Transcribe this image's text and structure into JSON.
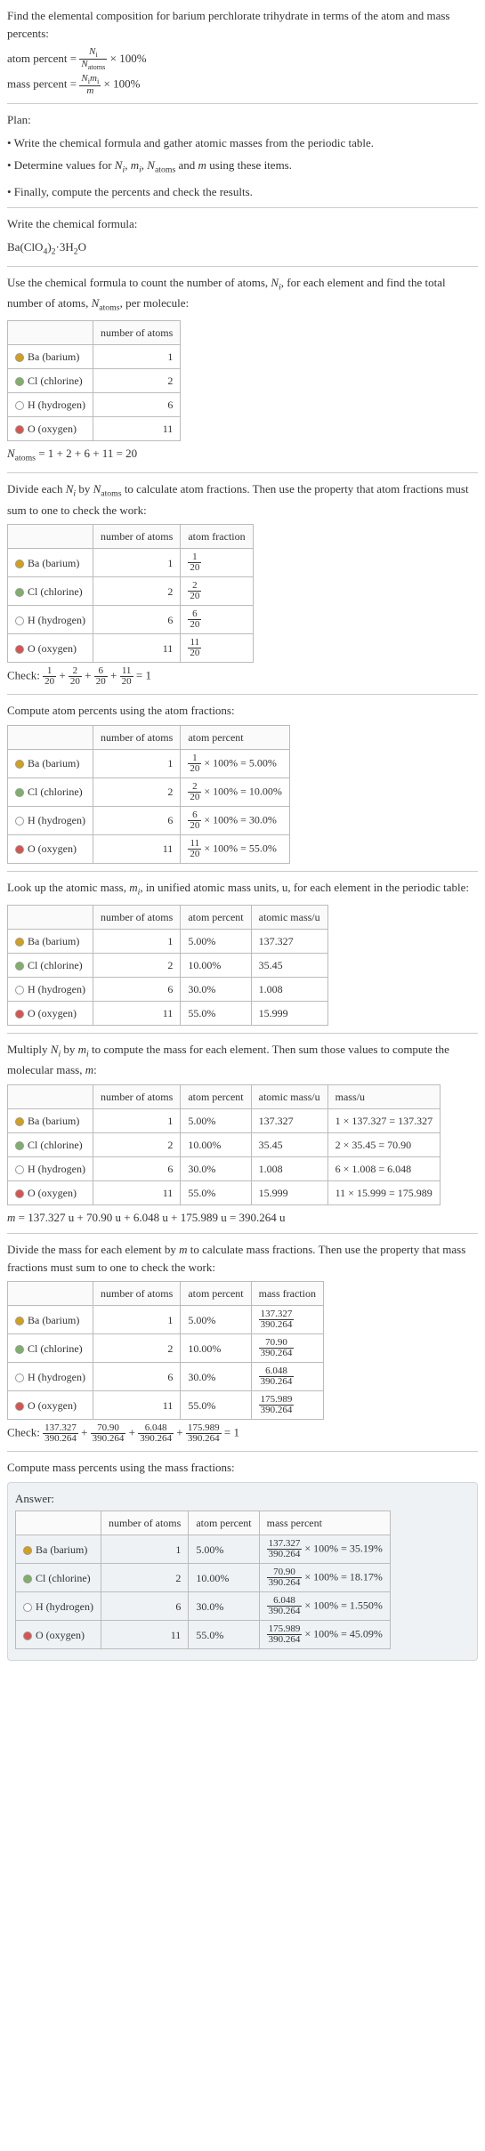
{
  "intro": {
    "title": "Find the elemental composition for barium perchlorate trihydrate in terms of the atom and mass percents:",
    "atom_percent_label": "atom percent",
    "atom_percent_eq_lhs": "N",
    "atom_percent_eq_sub_i": "i",
    "atom_percent_eq_denom": "N",
    "atom_percent_eq_denom_sub": "atoms",
    "times100": "× 100%",
    "mass_percent_label": "mass percent",
    "mass_num_N": "N",
    "mass_num_i": "i",
    "mass_num_m": "m",
    "mass_denom": "m"
  },
  "plan": {
    "heading": "Plan:",
    "b1": "• Write the chemical formula and gather atomic masses from the periodic table.",
    "b2_pre": "• Determine values for ",
    "b2_post": " using these items.",
    "b3": "• Finally, compute the percents and check the results."
  },
  "formula_section": {
    "heading": "Write the chemical formula:",
    "formula": "Ba(ClO",
    "sub4": "4",
    "paren": ")",
    "sub2": "2",
    "dot": "·3H",
    "sub2b": "2",
    "O": "O"
  },
  "count_section": {
    "intro_pre": "Use the chemical formula to count the number of atoms, ",
    "intro_post": ", for each element and find the total number of atoms, ",
    "intro_post2": ", per molecule:",
    "col_num": "number of atoms",
    "row_ba": "Ba (barium)",
    "val_ba": "1",
    "row_cl": "Cl (chlorine)",
    "val_cl": "2",
    "row_h": "H (hydrogen)",
    "val_h": "6",
    "row_o": "O (oxygen)",
    "val_o": "11",
    "sum": " = 1 + 2 + 6 + 11 = 20"
  },
  "frac_section": {
    "intro_pre": "Divide each ",
    "intro_mid": " by ",
    "intro_post": " to calculate atom fractions. Then use the property that atom fractions must sum to one to check the work:",
    "col_num": "number of atoms",
    "col_frac": "atom fraction",
    "row_ba": "Ba (barium)",
    "nba": "1",
    "fba_n": "1",
    "fba_d": "20",
    "row_cl": "Cl (chlorine)",
    "ncl": "2",
    "fcl_n": "2",
    "fcl_d": "20",
    "row_h": "H (hydrogen)",
    "nh": "6",
    "fh_n": "6",
    "fh_d": "20",
    "row_o": "O (oxygen)",
    "no": "11",
    "fo_n": "11",
    "fo_d": "20",
    "check_label": "Check: ",
    "check_eq": " = 1"
  },
  "atom_pct_section": {
    "intro": "Compute atom percents using the atom fractions:",
    "col_num": "number of atoms",
    "col_pct": "atom percent",
    "row_ba": "Ba (barium)",
    "nba": "1",
    "pba_n": "1",
    "pba_d": "20",
    "pba_val": " × 100% = 5.00%",
    "row_cl": "Cl (chlorine)",
    "ncl": "2",
    "pcl_n": "2",
    "pcl_d": "20",
    "pcl_val": " × 100% = 10.00%",
    "row_h": "H (hydrogen)",
    "nh": "6",
    "ph_n": "6",
    "ph_d": "20",
    "ph_val": " × 100% = 30.0%",
    "row_o": "O (oxygen)",
    "no": "11",
    "po_n": "11",
    "po_d": "20",
    "po_val": " × 100% = 55.0%"
  },
  "mass_section": {
    "intro_pre": "Look up the atomic mass, ",
    "intro_post": ", in unified atomic mass units, u, for each element in the periodic table:",
    "col_num": "number of atoms",
    "col_pct": "atom percent",
    "col_mass": "atomic mass/u",
    "row_ba": "Ba (barium)",
    "nba": "1",
    "pba": "5.00%",
    "mba": "137.327",
    "row_cl": "Cl (chlorine)",
    "ncl": "2",
    "pcl": "10.00%",
    "mcl": "35.45",
    "row_h": "H (hydrogen)",
    "nh": "6",
    "ph": "30.0%",
    "mh": "1.008",
    "row_o": "O (oxygen)",
    "no": "11",
    "po": "55.0%",
    "mo": "15.999"
  },
  "molmass_section": {
    "intro_pre": "Multiply ",
    "intro_mid": " by ",
    "intro_post": " to compute the mass for each element. Then sum those values to compute the molecular mass, ",
    "intro_post2": ":",
    "col_num": "number of atoms",
    "col_pct": "atom percent",
    "col_amass": "atomic mass/u",
    "col_mass": "mass/u",
    "row_ba": "Ba (barium)",
    "nba": "1",
    "pba": "5.00%",
    "aba": "137.327",
    "mba": "1 × 137.327 = 137.327",
    "row_cl": "Cl (chlorine)",
    "ncl": "2",
    "pcl": "10.00%",
    "acl": "35.45",
    "mcl": "2 × 35.45 = 70.90",
    "row_h": "H (hydrogen)",
    "nh": "6",
    "ph": "30.0%",
    "ah": "1.008",
    "mh": "6 × 1.008 = 6.048",
    "row_o": "O (oxygen)",
    "no": "11",
    "po": "55.0%",
    "ao": "15.999",
    "mo": "11 × 15.999 = 175.989",
    "sum": " = 137.327 u + 70.90 u + 6.048 u + 175.989 u = 390.264 u"
  },
  "massfrac_section": {
    "intro_pre": "Divide the mass for each element by ",
    "intro_post": " to calculate mass fractions. Then use the property that mass fractions must sum to one to check the work:",
    "col_num": "number of atoms",
    "col_pct": "atom percent",
    "col_mf": "mass fraction",
    "row_ba": "Ba (barium)",
    "nba": "1",
    "pba": "5.00%",
    "fba_n": "137.327",
    "fba_d": "390.264",
    "row_cl": "Cl (chlorine)",
    "ncl": "2",
    "pcl": "10.00%",
    "fcl_n": "70.90",
    "fcl_d": "390.264",
    "row_h": "H (hydrogen)",
    "nh": "6",
    "ph": "30.0%",
    "fh_n": "6.048",
    "fh_d": "390.264",
    "row_o": "O (oxygen)",
    "no": "11",
    "po": "55.0%",
    "fo_n": "175.989",
    "fo_d": "390.264",
    "check_label": "Check: ",
    "check_eq": " = 1"
  },
  "final_section": {
    "intro": "Compute mass percents using the mass fractions:",
    "answer_label": "Answer:",
    "col_num": "number of atoms",
    "col_pct": "atom percent",
    "col_mp": "mass percent",
    "row_ba": "Ba (barium)",
    "nba": "1",
    "pba": "5.00%",
    "fba_n": "137.327",
    "fba_d": "390.264",
    "vba": " × 100% = 35.19%",
    "row_cl": "Cl (chlorine)",
    "ncl": "2",
    "pcl": "10.00%",
    "fcl_n": "70.90",
    "fcl_d": "390.264",
    "vcl": " × 100% = 18.17%",
    "row_h": "H (hydrogen)",
    "nh": "6",
    "ph": "30.0%",
    "fh_n": "6.048",
    "fh_d": "390.264",
    "vh": " × 100% = 1.550%",
    "row_o": "O (oxygen)",
    "no": "11",
    "po": "55.0%",
    "fo_n": "175.989",
    "fo_d": "390.264",
    "vo": " × 100% = 45.09%"
  }
}
